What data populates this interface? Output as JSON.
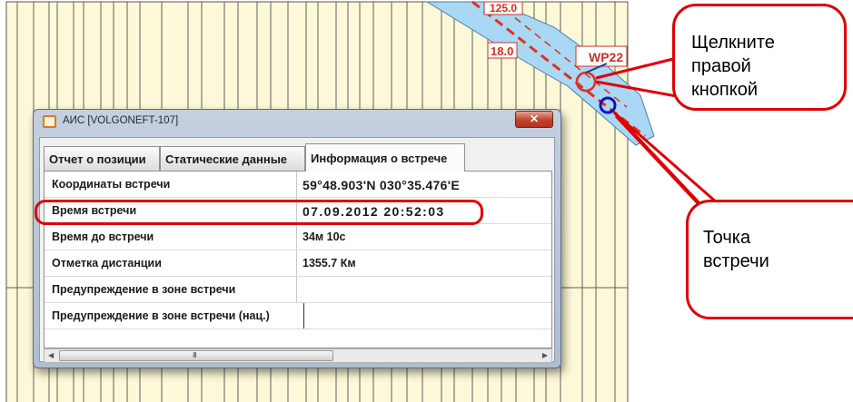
{
  "map": {
    "waypoint_label": "WP22",
    "depth_label_1": "18.0",
    "depth_label_2": "125.0"
  },
  "window": {
    "title": "АИС [VOLGONEFT-107]",
    "tabs": [
      {
        "label": "Отчет о позиции",
        "active": false
      },
      {
        "label": "Статические данные",
        "active": false
      },
      {
        "label": "Информация о встрече",
        "active": true
      }
    ],
    "rows": [
      {
        "key": "Координаты встречи",
        "value": "59°48.903'N 030°35.476'E"
      },
      {
        "key": "Время встречи",
        "value": "07.09.2012 20:52:03"
      },
      {
        "key": "Время до встречи",
        "value": "34м 10с"
      },
      {
        "key": "Отметка дистанции",
        "value": "1355.7 Км"
      },
      {
        "key": "Предупреждение в зоне встречи",
        "value": ""
      },
      {
        "key": "Предупреждение в зоне встречи (нац.)",
        "value": ""
      }
    ],
    "scroll_grip": "III"
  },
  "callouts": {
    "right_click_line1": "Щелкните",
    "right_click_line2": "правой",
    "right_click_line3": "кнопкой",
    "meeting_point_line1": "Точка",
    "meeting_point_line2": "встречи"
  },
  "colors": {
    "chart_background": "#fdf9d8",
    "water": "#a8d8f4",
    "callout_red": "#e00000",
    "meeting_point_blue": "#1010c0"
  }
}
